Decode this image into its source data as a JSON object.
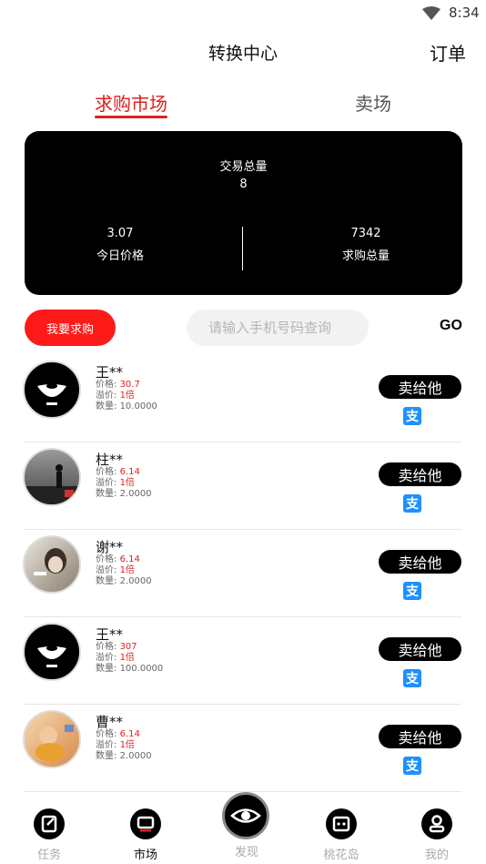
{
  "status_bar": {
    "time": "8:34"
  },
  "header": {
    "title": "转换中心",
    "orders": "订单"
  },
  "tabs": {
    "buy": "求购市场",
    "sell": "卖场"
  },
  "summary": {
    "total_label": "交易总量",
    "total_value": "8",
    "today_price_value": "3.07",
    "today_price_label": "今日价格",
    "buy_total_value": "7342",
    "buy_total_label": "求购总量"
  },
  "actions": {
    "buy_button": "我要求购",
    "search_placeholder": "请输入手机号码查询",
    "go": "GO"
  },
  "labels": {
    "price": "价格:",
    "premium": "溢价:",
    "quantity": "数量:",
    "sell": "卖给他"
  },
  "listings": [
    {
      "name": "王**",
      "price": "30.7",
      "premium": "1倍",
      "quantity": "10.0000",
      "avatar": "logo-black"
    },
    {
      "name": "柱**",
      "price": "6.14",
      "premium": "1倍",
      "quantity": "2.0000",
      "avatar": "photo-silhouette"
    },
    {
      "name": "谢**",
      "price": "6.14",
      "premium": "1倍",
      "quantity": "2.0000",
      "avatar": "photo-person"
    },
    {
      "name": "王**",
      "price": "307",
      "premium": "1倍",
      "quantity": "100.0000",
      "avatar": "logo-black"
    },
    {
      "name": "曹**",
      "price": "6.14",
      "premium": "1倍",
      "quantity": "2.0000",
      "avatar": "photo-child"
    }
  ],
  "nav": {
    "task": "任务",
    "market": "市场",
    "discover": "发现",
    "island": "桃花岛",
    "mine": "我的"
  },
  "colors": {
    "accent": "#e02020",
    "alipay": "#1e90ff"
  }
}
